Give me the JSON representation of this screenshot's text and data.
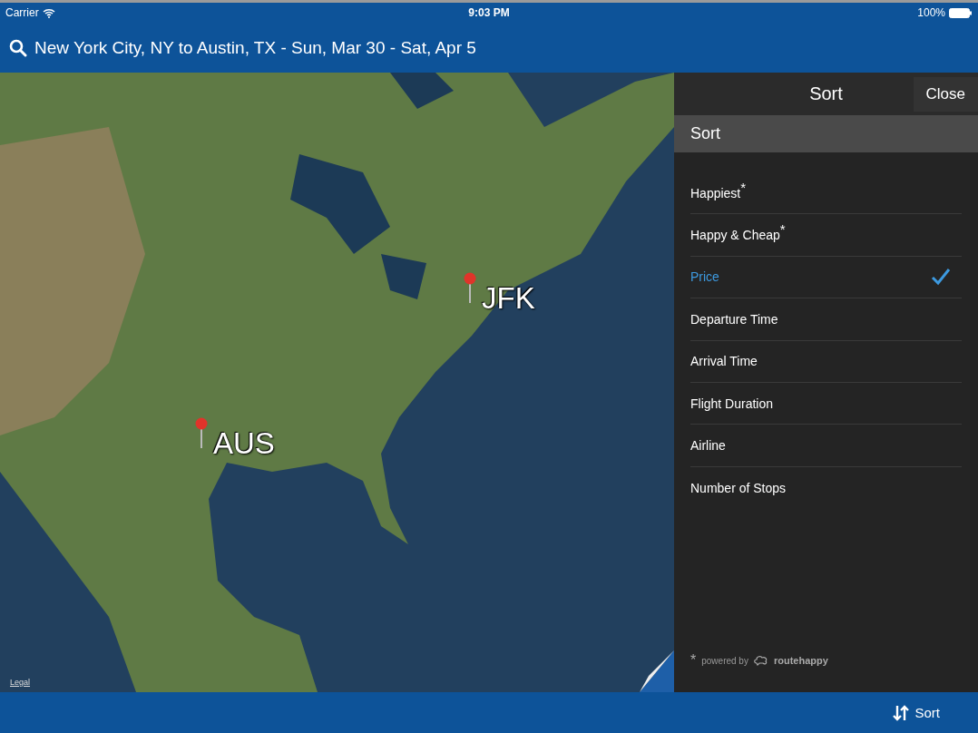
{
  "status_bar": {
    "carrier": "Carrier",
    "time": "9:03 PM",
    "battery": "100%"
  },
  "search": {
    "value": "New York City, NY to Austin, TX - Sun, Mar 30 - Sat, Apr 5"
  },
  "map": {
    "pins": [
      {
        "label": "JFK"
      },
      {
        "label": "AUS"
      }
    ],
    "legal": "Legal"
  },
  "sort_panel": {
    "title": "Sort",
    "close": "Close",
    "section": "Sort",
    "options": [
      {
        "label": "Happiest$^{*}$",
        "selected": false
      },
      {
        "label": "Happy & Cheap$^{*}$",
        "selected": false
      },
      {
        "label": "Price",
        "selected": true
      },
      {
        "label": "Departure Time",
        "selected": false
      },
      {
        "label": "Arrival Time",
        "selected": false
      },
      {
        "label": "Flight Duration",
        "selected": false
      },
      {
        "label": "Airline",
        "selected": false
      },
      {
        "label": "Number of Stops",
        "selected": false
      }
    ],
    "footnote": {
      "mark": "*",
      "text": "powered by",
      "brand": "routehappy"
    }
  },
  "bottom_bar": {
    "sort": "Sort"
  }
}
